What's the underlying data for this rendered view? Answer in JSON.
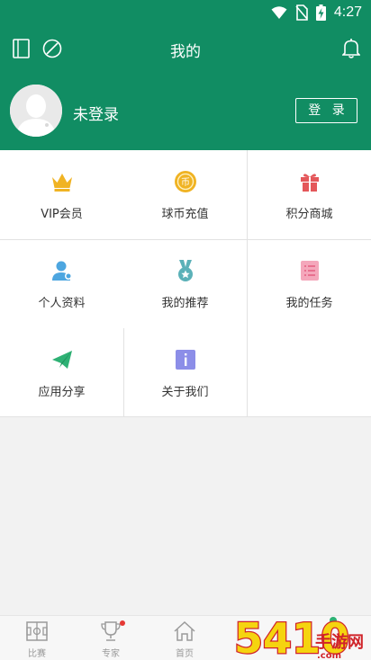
{
  "status": {
    "time": "4:27"
  },
  "header": {
    "title": "我的"
  },
  "profile": {
    "name": "未登录",
    "login_label": "登 录"
  },
  "menu": [
    {
      "label": "VIP会员",
      "icon": "crown-icon"
    },
    {
      "label": "球币充值",
      "icon": "coin-icon"
    },
    {
      "label": "积分商城",
      "icon": "gift-icon"
    },
    {
      "label": "个人资料",
      "icon": "user-profile-icon"
    },
    {
      "label": "我的推荐",
      "icon": "medal-icon"
    },
    {
      "label": "我的任务",
      "icon": "task-list-icon"
    },
    {
      "label": "应用分享",
      "icon": "paper-plane-icon"
    },
    {
      "label": "关于我们",
      "icon": "info-icon"
    }
  ],
  "nav": [
    {
      "label": "比赛",
      "icon": "pitch-icon"
    },
    {
      "label": "专家",
      "icon": "trophy-icon"
    },
    {
      "label": "首页",
      "icon": "home-icon"
    }
  ],
  "colors": {
    "brand": "#118d63",
    "gold": "#f0b323",
    "red": "#e4575a",
    "blue": "#4da6e0",
    "teal": "#5bb1b8",
    "pink": "#e86f8e",
    "green": "#2eb174",
    "purple": "#8c8ee8"
  }
}
